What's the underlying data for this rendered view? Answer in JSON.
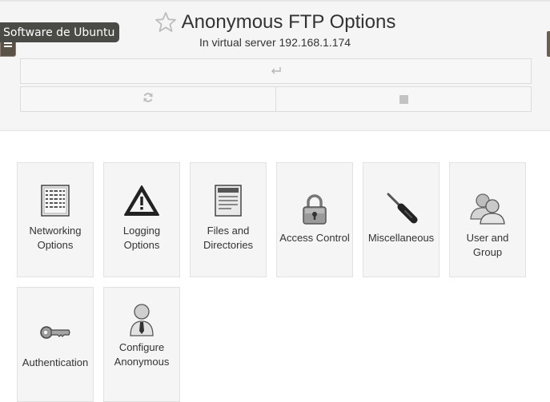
{
  "header": {
    "title": "Anonymous FTP Options",
    "subtitle": "In virtual server 192.168.1.174",
    "return_icon": "return-arrow-icon",
    "refresh_icon": "refresh-icon",
    "stop_icon": "stop-icon"
  },
  "tooltip": {
    "text": "Software de Ubuntu"
  },
  "tiles": [
    {
      "label": "Networking Options",
      "icon": "binary-data-icon"
    },
    {
      "label": "Logging Options",
      "icon": "warning-icon"
    },
    {
      "label": "Files and Directories",
      "icon": "document-icon"
    },
    {
      "label": "Access Control",
      "icon": "padlock-icon"
    },
    {
      "label": "Miscellaneous",
      "icon": "screwdriver-icon"
    },
    {
      "label": "User and Group",
      "icon": "users-icon"
    },
    {
      "label": "Authentication",
      "icon": "key-icon"
    },
    {
      "label": "Configure Anonymous",
      "icon": "user-icon"
    }
  ]
}
